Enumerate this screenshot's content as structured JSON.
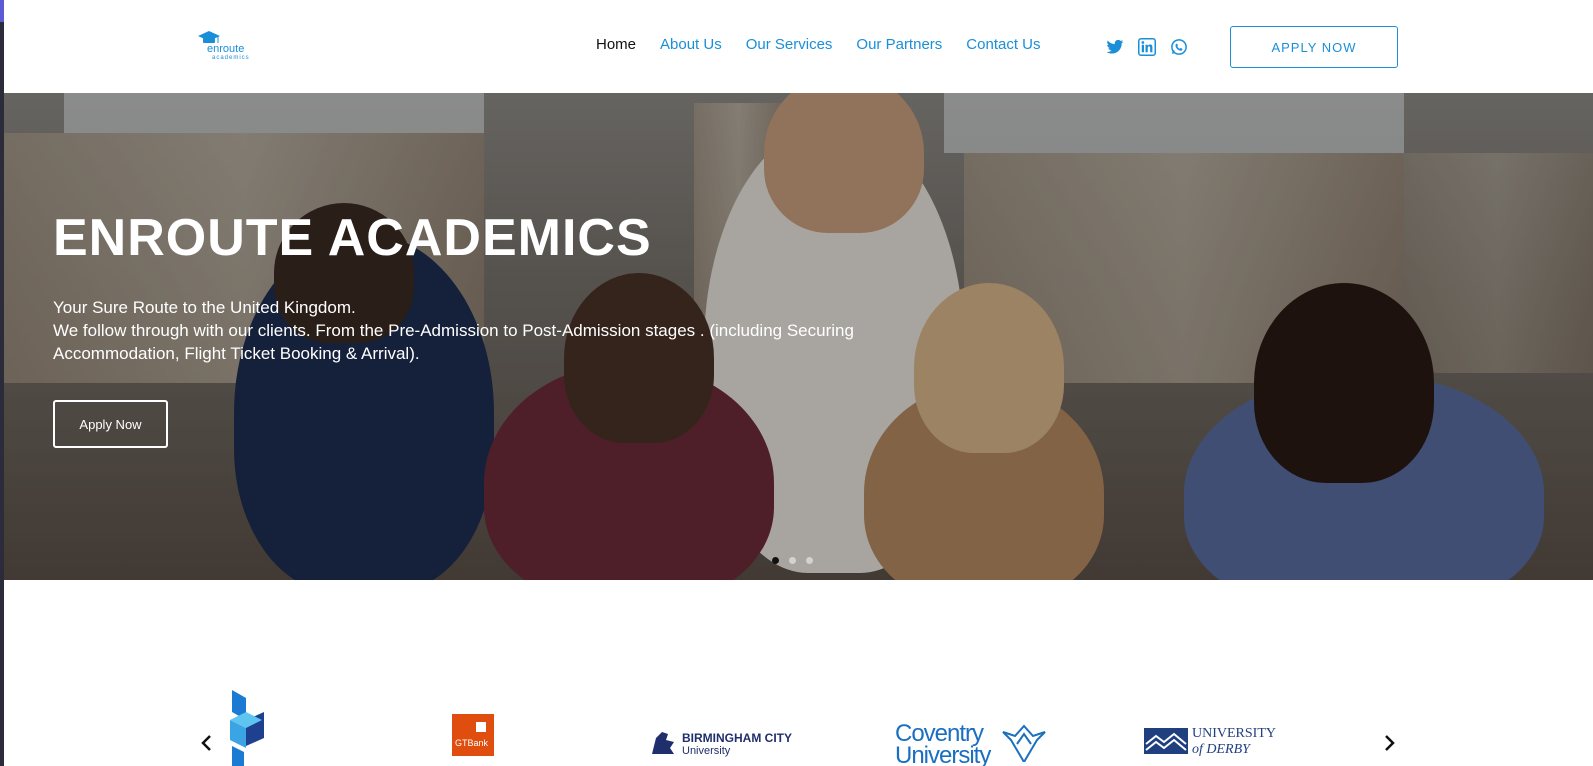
{
  "header": {
    "logo_text": "enroute",
    "logo_sub": "academics",
    "nav": [
      {
        "label": "Home",
        "active": true
      },
      {
        "label": "About Us"
      },
      {
        "label": "Our Services"
      },
      {
        "label": "Our Partners"
      },
      {
        "label": "Contact Us"
      }
    ],
    "socials": [
      "twitter-icon",
      "linkedin-icon",
      "whatsapp-icon"
    ],
    "apply_label": "APPLY NOW"
  },
  "hero": {
    "title": "ENROUTE ACADEMICS",
    "line1": "Your Sure Route to the United Kingdom.",
    "line2": "We follow through with our clients. From the Pre-Admission to Post-Admission stages . (including Securing",
    "line3": "Accommodation, Flight Ticket Booking & Arrival).",
    "button_label": "Apply Now",
    "slides": 3,
    "active_slide": 1
  },
  "partners": {
    "logos": [
      {
        "name": "cube-logo",
        "text": ""
      },
      {
        "name": "gtbank-logo",
        "text": "GTBank"
      },
      {
        "name": "birmingham-city-logo",
        "text": "BIRMINGHAM CITY",
        "sub": "University"
      },
      {
        "name": "coventry-logo",
        "text": "Coventry",
        "sub": "University"
      },
      {
        "name": "derby-logo",
        "text": "UNIVERSITY",
        "sub": "of DERBY"
      }
    ]
  },
  "colors": {
    "accent": "#1a8fd8",
    "gtbank": "#e04e0f",
    "coventry": "#1a6fc0",
    "navy": "#1f2f6b"
  }
}
